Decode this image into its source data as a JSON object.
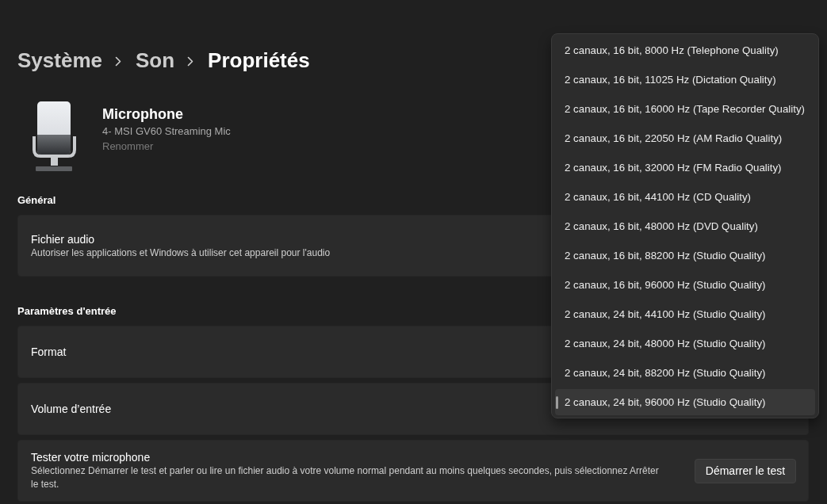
{
  "breadcrumb": [
    {
      "label": "Système",
      "current": false
    },
    {
      "label": "Son",
      "current": false
    },
    {
      "label": "Propriétés",
      "current": true
    }
  ],
  "device": {
    "name": "Microphone",
    "model": "4- MSI GV60 Streaming Mic",
    "rename_link": {
      "label": "Renommer",
      "disabled": true
    }
  },
  "general": {
    "heading": "Général",
    "cards": [
      {
        "title": "Fichier audio",
        "description": "Autoriser les applications et Windows à utiliser cet appareil pour l'audio"
      }
    ]
  },
  "input_settings": {
    "heading": "Paramètres d'entrée",
    "cards": [
      {
        "title": "Format",
        "menu": {
          "options": [
            {
              "label": "2 canaux, 16 bit, 8000 Hz (Telephone Quality)",
              "selected": false
            },
            {
              "label": "2 canaux, 16 bit, 11025 Hz (Dictation Quality)",
              "selected": false
            },
            {
              "label": "2 canaux, 16 bit, 16000 Hz (Tape Recorder Quality)",
              "selected": false
            },
            {
              "label": "2 canaux, 16 bit, 22050 Hz (AM Radio Quality)",
              "selected": false
            },
            {
              "label": "2 canaux, 16 bit, 32000 Hz (FM Radio Quality)",
              "selected": false
            },
            {
              "label": "2 canaux, 16 bit, 44100 Hz (CD Quality)",
              "selected": false
            },
            {
              "label": "2 canaux, 16 bit, 48000 Hz (DVD Quality)",
              "selected": false
            },
            {
              "label": "2 canaux, 16 bit, 88200 Hz (Studio Quality)",
              "selected": false
            },
            {
              "label": "2 canaux, 16 bit, 96000 Hz (Studio Quality)",
              "selected": false
            },
            {
              "label": "2 canaux, 24 bit, 44100 Hz (Studio Quality)",
              "selected": false
            },
            {
              "label": "2 canaux, 24 bit, 48000 Hz (Studio Quality)",
              "selected": false
            },
            {
              "label": "2 canaux, 24 bit, 88200 Hz (Studio Quality)",
              "selected": false
            },
            {
              "label": "2 canaux, 24 bit, 96000 Hz (Studio Quality)",
              "selected": true
            }
          ]
        }
      },
      {
        "title": "Volume d’entrée"
      },
      {
        "title": "Tester votre microphone",
        "description": "Sélectionnez Démarrer le test et parler ou lire un fichier audio à votre volume normal pendant au moins quelques secondes, puis sélectionnez Arrêter le test.",
        "button": "Démarrer le test"
      }
    ]
  }
}
